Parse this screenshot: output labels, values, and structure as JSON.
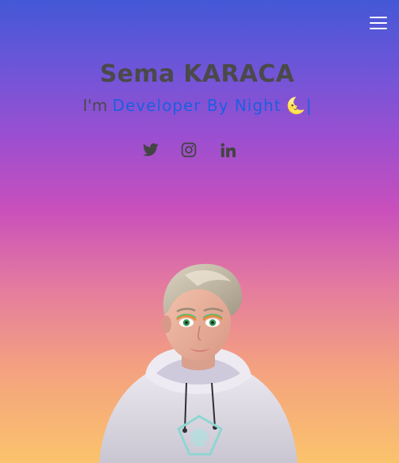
{
  "header": {
    "menu_icon": "hamburger-menu-icon"
  },
  "hero": {
    "name": "Sema KARACA",
    "intro": "I'm",
    "role": "Developer By Night",
    "emoji": "🌜",
    "cursor": "|"
  },
  "socials": [
    {
      "icon": "twitter-icon"
    },
    {
      "icon": "instagram-icon"
    },
    {
      "icon": "linkedin-icon"
    }
  ],
  "colors": {
    "gradient_top": "#4358d6",
    "gradient_middle": "#c84fbc",
    "gradient_bottom": "#fbc36c",
    "title_text": "#4a4a4a",
    "accent": "#1c5fe0",
    "icon": "#444444"
  },
  "avatar": {
    "icon": "3d-avatar-illustration"
  }
}
